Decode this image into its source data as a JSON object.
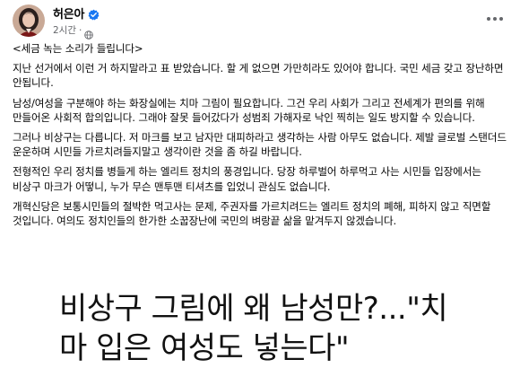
{
  "post": {
    "author": "허은아",
    "timestamp": "2시간",
    "separator": "·",
    "verified_icon": "verified-badge-icon",
    "privacy_icon": "globe-icon",
    "accent_color": "#1877f2",
    "paragraphs": [
      "<세금 녹는 소리가 들립니다>",
      "지난 선거에서 이런 거 하지말라고 표 받았습니다. 할 게 없으면 가만히라도 있어야 합니다. 국민 세금 갖고 장난하면 안됩니다.",
      "남성/여성을 구분해야 하는 화장실에는 치마 그림이 필요합니다. 그건 우리 사회가 그리고 전세계가 편의를 위해 만들어온 사회적 합의입니다. 그래야 잘못 들어갔다가 성범죄 가해자로 낙인 찍히는 일도 방지할 수 있습니다.",
      "그러나 비상구는 다릅니다. 저 마크를 보고 남자만 대피하라고 생각하는 사람 아무도 없습니다. 제발 글로벌 스탠더드 운운하며 시민들 가르치려들지말고 생각이란 것을 좀 하길 바랍니다.",
      "전형적인 우리 정치를 병들게 하는 엘리트 정치의 풍경입니다. 당장 하루벌어 하루먹고 사는 시민들 입장에서는 비상구 마크가 어떻니, 누가 무슨 맨투맨 티셔츠를 입었니 관심도 없습니다.",
      "개혁신당은 보통시민들의 절박한 먹고사는 문제, 주권자를 가르치려드는 엘리트 정치의 폐해, 피하지 않고 직면할 것입니다. 여의도 정치인들의 한가한 소꿉장난에 국민의 벼랑끝 삶을 맡겨두지 않겠습니다."
    ]
  },
  "headline": {
    "line1": "비상구 그림에 왜 남성만?...\"치",
    "line2": "마 입은 여성도 넣는다\""
  }
}
